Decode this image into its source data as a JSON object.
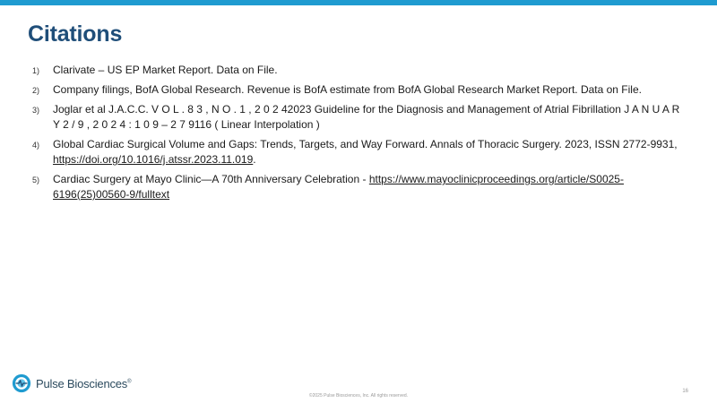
{
  "slide": {
    "title": "Citations",
    "accent_color": "#1f9bd0",
    "title_color": "#1f4e79"
  },
  "citations": [
    {
      "number": "1)",
      "text": "Clarivate – US EP Market Report. Data on File.",
      "link": "",
      "suffix": ""
    },
    {
      "number": "2)",
      "text": "Company filings, BofA Global Research. Revenue is BofA estimate from BofA Global Research Market Report. Data on File.",
      "link": "",
      "suffix": ""
    },
    {
      "number": "3)",
      "text": "Joglar et al J.A.C.C. V O L . 8 3 , N O . 1 , 2 0 2 42023 Guideline for the Diagnosis and Management of Atrial Fibrillation J A N U A R Y 2 / 9 , 2 0 2 4 : 1 0 9 – 2 7 9116 ( Linear Interpolation )",
      "link": "",
      "suffix": ""
    },
    {
      "number": "4)",
      "text": "Global Cardiac Surgical Volume and Gaps: Trends, Targets, and Way Forward. Annals of Thoracic Surgery. 2023, ISSN 2772-9931, ",
      "link": "https://doi.org/10.1016/j.atssr.2023.11.019",
      "suffix": "."
    },
    {
      "number": "5)",
      "text": "Cardiac Surgery at Mayo Clinic—A 70th Anniversary Celebration - ",
      "link": "https://www.mayoclinicproceedings.org/article/S0025-6196(25)00560-9/fulltext",
      "suffix": ""
    }
  ],
  "footer": {
    "brand": "Pulse Biosciences",
    "trademark": "®",
    "icon": "pulse-logo-icon",
    "copyright": "©2025 Pulse Biosciences, Inc. All rights reserved.",
    "page_number": "16"
  }
}
